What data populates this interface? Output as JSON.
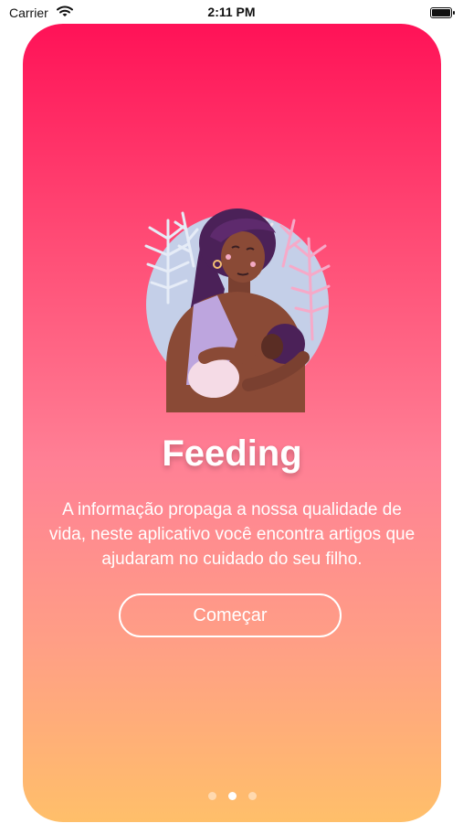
{
  "status_bar": {
    "carrier": "Carrier",
    "time": "2:11 PM",
    "icons": [
      "wifi-icon",
      "battery-icon"
    ]
  },
  "onboarding": {
    "title": "Feeding",
    "description": "A informação propaga a nossa qualidade de vida, neste aplicativo você encontra artigos que ajudaram no cuidado do seu filho.",
    "button_label": "Começar",
    "illustration": "mother-breastfeeding-illustration",
    "page_index": 2,
    "page_count": 3
  },
  "colors": {
    "gradient_top": "#ff1257",
    "gradient_middle": "#ff8095",
    "gradient_bottom": "#ffbf6a",
    "text": "#ffffff"
  }
}
